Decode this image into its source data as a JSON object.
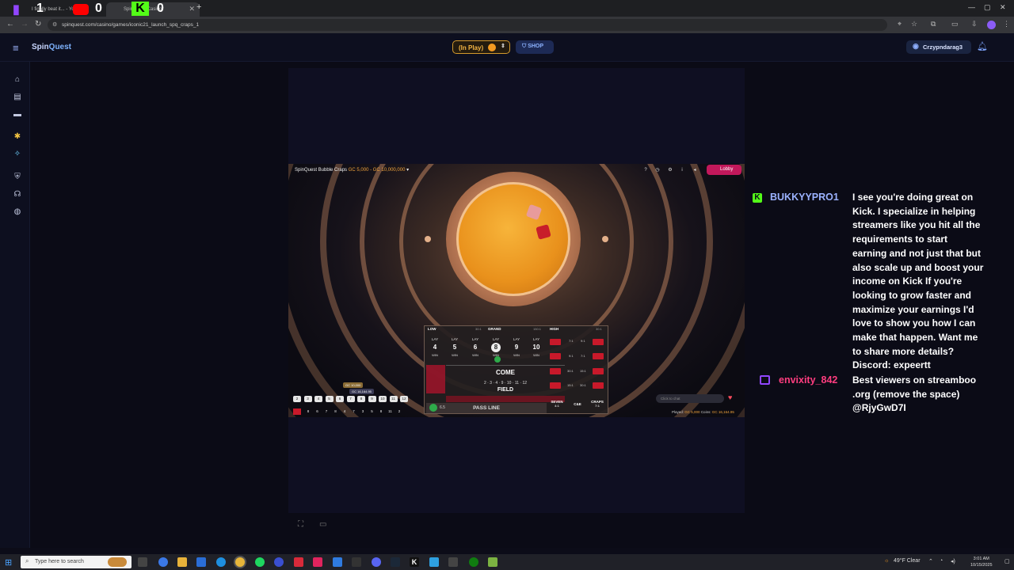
{
  "browser": {
    "tabs": [
      {
        "label": "I finally beat it... - YouTube",
        "fav": "youtube-icon"
      },
      {
        "label": "SpinQuest Casino",
        "fav": "spinquest-icon"
      },
      {
        "label": "SpinQuest Casino",
        "fav": "spinquest-icon"
      }
    ],
    "overlay_counters": [
      "1",
      "0",
      "0"
    ],
    "url": "spinquest.com/casino/games/iconic21_launch_spq_craps_1",
    "new_tab": "+"
  },
  "site": {
    "brand_a": "Spin",
    "brand_b": "Quest",
    "in_play_label": "(In Play)",
    "shop_label": "SHOP",
    "username": "Crzypndarag3"
  },
  "game": {
    "title": "SpinQuest Bubble Craps",
    "limits": "GC 5,000 - GC 10,000,000",
    "lobby_label": "Lobby",
    "table": {
      "low_label": "LOW",
      "low_odds": "30:1",
      "grand_label": "GRAND",
      "grand_odds": "150:1",
      "high_label": "HIGH",
      "high_odds": "30:1",
      "points": [
        {
          "top": "LAY",
          "num": "4",
          "bottom": "WIN"
        },
        {
          "top": "LAY",
          "num": "5",
          "bottom": "WIN"
        },
        {
          "top": "LAY",
          "num": "6",
          "bottom": "WIN"
        },
        {
          "top": "LAY",
          "num": "8",
          "bottom": "WIN"
        },
        {
          "top": "LAY",
          "num": "9",
          "bottom": "WIN"
        },
        {
          "top": "LAY",
          "num": "10",
          "bottom": "WIN"
        }
      ],
      "come_label": "COME",
      "field_label": "FIELD",
      "field_nums": "2 · 3 · 4 · 9 · 10 · 11 · 12",
      "pass_line_label": "PASS LINE",
      "pass_line_chip": "6.5",
      "seven_label": "SEVEN",
      "seven_odds": "4:1",
      "ce_label": "C&E",
      "craps_label": "CRAPS",
      "craps_odds": "7:1",
      "hard_odds": [
        "7:1",
        "9:1",
        "9:1",
        "7:1",
        "30:1",
        "15:1",
        "15:1",
        "30:1"
      ]
    },
    "history_top": [
      "2",
      "3",
      "4",
      "5",
      "6",
      "7",
      "8",
      "9",
      "10",
      "11",
      "12"
    ],
    "history_bottom": [
      "8",
      "6",
      "7",
      "8",
      "4",
      "7",
      "3",
      "5",
      "8",
      "11",
      "2"
    ],
    "gc_tag_1": "GC 10,000",
    "gc_tag_2": "GC 16,164.95",
    "chat_placeholder": "Click to chat",
    "played_label": "Played:",
    "played_value": "GC 5,000",
    "coins_label": "Coins:",
    "coins_value": "GC 16,164.95"
  },
  "chat": {
    "user1": "BUKKYYPRO1",
    "msg1_lines": [
      "I see you're doing great on",
      "Kick. I specialize in helping",
      "streamers like you hit all the",
      "requirements to start",
      "earning and not just that but",
      "also scale up and boost your",
      "income on Kick If you're",
      "looking to grow faster and",
      "maximize your earnings I'd",
      "love to show you how I can",
      "make that happen. Want me",
      "to share more details?",
      "Discord: expeertt"
    ],
    "user2": "envixity_842",
    "msg2_lines": [
      "Best viewers on streamboo",
      ".org (remove the space)",
      "@RjyGwD7I"
    ]
  },
  "taskbar": {
    "search_placeholder": "Type here to search",
    "weather": "49°F Clear",
    "time": "3:01 AM",
    "date": "10/15/2025"
  },
  "colors": {
    "accent_blue": "#7fb4ff",
    "in_play_orange": "#f4b544",
    "lobby_pink": "#c2185b",
    "kick_green": "#53fc18",
    "twitch_purple": "#9146ff"
  }
}
